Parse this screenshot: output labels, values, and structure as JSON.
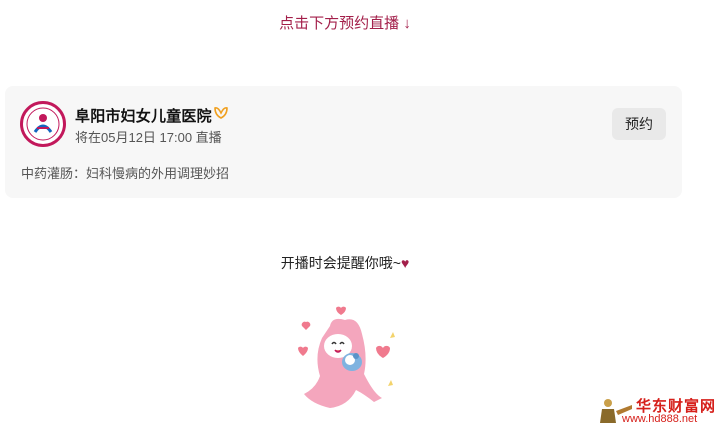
{
  "top_hint": "点击下方预约直播 ↓",
  "card": {
    "org_name": "阜阳市妇女儿童医院",
    "schedule": "将在05月12日 17:00 直播",
    "reserve_label": "预约",
    "description": "中药灌肠：妇科慢病的外用调理妙招"
  },
  "remind": {
    "text": "开播时会提醒你哦~",
    "heart": "♥"
  },
  "watermark": {
    "title": "华东财富网",
    "url": "www.hd888.net"
  },
  "colors": {
    "accent": "#a31f4a",
    "card_bg": "#f7f7f7",
    "button_bg": "#e9e9e9",
    "sticker_pink": "#f4a6bd",
    "watermark_red": "#d6201b"
  }
}
